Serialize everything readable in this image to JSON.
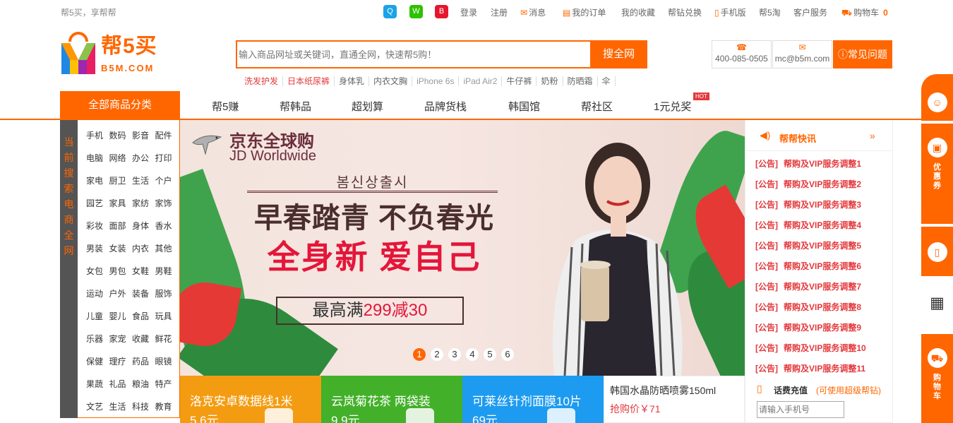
{
  "topbar": {
    "slogan": "帮5买，享帮帮",
    "social": [
      {
        "icon": "qq-icon",
        "color": "#1aa3e8",
        "glyph": "Q"
      },
      {
        "icon": "wechat-icon",
        "color": "#2dc100",
        "glyph": "W"
      },
      {
        "icon": "weibo-icon",
        "color": "#e6162d",
        "glyph": "B"
      }
    ],
    "login": "登录",
    "register": "注册",
    "messages": "消息",
    "orders": "我的订单",
    "favorites": "我的收藏",
    "diamond_exchange": "帮钻兑换",
    "mobile": "手机版",
    "tao": "帮5淘",
    "service": "客户服务",
    "cart": "购物车",
    "cart_count": "0"
  },
  "header": {
    "logo_name": "帮5买",
    "logo_domain": "B5M.COM",
    "search_placeholder": "输入商品网址或关键词，直通全网，快速帮5购！",
    "search_button": "搜全网",
    "hot_words": [
      {
        "text": "洗发护发",
        "style": "red"
      },
      {
        "text": "日本纸尿裤",
        "style": "red"
      },
      {
        "text": "身体乳",
        "style": "normal"
      },
      {
        "text": "内衣文胸",
        "style": "normal"
      },
      {
        "text": "iPhone 6s",
        "style": "gray"
      },
      {
        "text": "iPad Air2",
        "style": "gray"
      },
      {
        "text": "牛仔裤",
        "style": "normal"
      },
      {
        "text": "奶粉",
        "style": "normal"
      },
      {
        "text": "防晒霜",
        "style": "normal"
      },
      {
        "text": "伞",
        "style": "normal"
      }
    ],
    "phone": "400-085-0505",
    "email": "mc@b5m.com",
    "faq": "常见问题"
  },
  "nav": {
    "all_categories": "全部商品分类",
    "items": [
      "帮5赚",
      "帮韩品",
      "超划算",
      "品牌货栈",
      "韩国馆",
      "帮社区",
      "1元兑奖"
    ],
    "hot_badge": "HOT"
  },
  "category": {
    "side_label": [
      "当",
      "前",
      "搜",
      "索",
      "电",
      "商",
      "",
      "全",
      "网"
    ],
    "rows": [
      [
        "手机",
        "数码",
        "影音",
        "配件"
      ],
      [
        "电脑",
        "网络",
        "办公",
        "打印"
      ],
      [
        "家电",
        "厨卫",
        "生活",
        "个户"
      ],
      [
        "园艺",
        "家具",
        "家纺",
        "家饰"
      ],
      [
        "彩妆",
        "面部",
        "身体",
        "香水"
      ],
      [
        "男装",
        "女装",
        "内衣",
        "其他"
      ],
      [
        "女包",
        "男包",
        "女鞋",
        "男鞋"
      ],
      [
        "运动",
        "户外",
        "装备",
        "服饰"
      ],
      [
        "儿童",
        "婴儿",
        "食品",
        "玩具"
      ],
      [
        "乐器",
        "家宠",
        "收藏",
        "鲜花"
      ],
      [
        "保健",
        "理疗",
        "药品",
        "眼镜"
      ],
      [
        "果蔬",
        "礼品",
        "粮油",
        "特产"
      ],
      [
        "文艺",
        "生活",
        "科技",
        "教育"
      ]
    ]
  },
  "banner": {
    "brand_cn": "京东全球购",
    "brand_en": "JD Worldwide",
    "korean": "봄신상출시",
    "headline1": "早春踏青 不负春光",
    "headline2": "全身新 爱自己",
    "promo_prefix": "最高满",
    "promo_red": "299减30",
    "dots": [
      "1",
      "2",
      "3",
      "4",
      "5",
      "6"
    ],
    "active_dot": 0
  },
  "products": [
    {
      "title": "洛克安卓数据线1米",
      "price": "5.6元",
      "color": "#f39c12"
    },
    {
      "title": "云岚菊花茶 两袋装",
      "price": "9.9元",
      "color": "#43b02a"
    },
    {
      "title": "可莱丝针剂面膜10片",
      "price": "69元",
      "color": "#1d9bf0"
    },
    {
      "title": "韩国水晶防晒喷雾150ml",
      "price": "抢购价￥71",
      "color": "#ffffff"
    }
  ],
  "news": {
    "title": "帮帮快讯",
    "more": "»",
    "items": [
      {
        "tag": "[公告]",
        "text": "帮购及VIP服务调整1"
      },
      {
        "tag": "[公告]",
        "text": "帮购及VIP服务调整2"
      },
      {
        "tag": "[公告]",
        "text": "帮购及VIP服务调整3"
      },
      {
        "tag": "[公告]",
        "text": "帮购及VIP服务调整4"
      },
      {
        "tag": "[公告]",
        "text": "帮购及VIP服务调整5"
      },
      {
        "tag": "[公告]",
        "text": "帮购及VIP服务调整6"
      },
      {
        "tag": "[公告]",
        "text": "帮购及VIP服务调整7"
      },
      {
        "tag": "[公告]",
        "text": "帮购及VIP服务调整8"
      },
      {
        "tag": "[公告]",
        "text": "帮购及VIP服务调整9"
      },
      {
        "tag": "[公告]",
        "text": "帮购及VIP服务调整10"
      },
      {
        "tag": "[公告]",
        "text": "帮购及VIP服务调整11"
      }
    ]
  },
  "recharge": {
    "title": "话费充值",
    "note": "(可使用超级帮钻)",
    "placeholder": "请输入手机号"
  },
  "floatbar": {
    "coupon_label": "优惠券",
    "cart_label": "购物车"
  },
  "colors": {
    "accent": "#ff6600",
    "red": "#e4393c"
  }
}
